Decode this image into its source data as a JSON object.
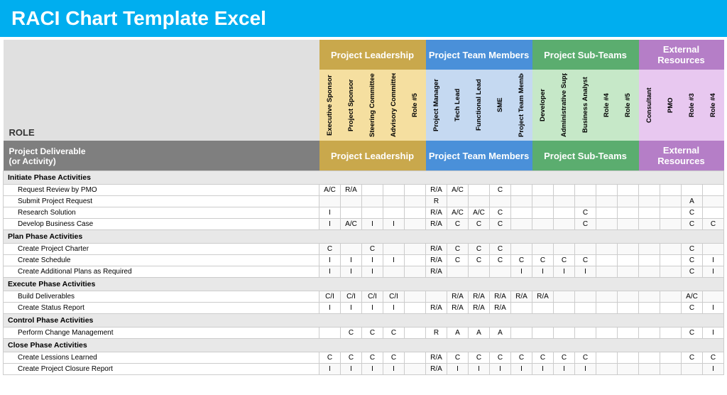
{
  "title": "RACI Chart Template Excel",
  "role_label": "ROLE",
  "deliverable_label": "Project Deliverable\n(or Activity)",
  "groups": [
    {
      "label": "Project Leadership",
      "class": "group-leadership",
      "col_class": "col-leadership",
      "span": 5
    },
    {
      "label": "Project Team Members",
      "class": "group-team",
      "col_class": "col-team",
      "span": 5
    },
    {
      "label": "Project Sub-Teams",
      "class": "group-subteams",
      "col_class": "col-subteams",
      "span": 5
    },
    {
      "label": "External Resources",
      "class": "group-external",
      "col_class": "col-external",
      "span": 4
    }
  ],
  "columns": [
    {
      "label": "Executive Sponsor",
      "group": "leadership"
    },
    {
      "label": "Project Sponsor",
      "group": "leadership"
    },
    {
      "label": "Steering Committee",
      "group": "leadership"
    },
    {
      "label": "Advisory Committee",
      "group": "leadership"
    },
    {
      "label": "Role #5",
      "group": "leadership"
    },
    {
      "label": "Project Manager",
      "group": "team"
    },
    {
      "label": "Tech Lead",
      "group": "team"
    },
    {
      "label": "Functional Lead",
      "group": "team"
    },
    {
      "label": "SME",
      "group": "team"
    },
    {
      "label": "Project Team Member",
      "group": "team"
    },
    {
      "label": "Developer",
      "group": "subteams"
    },
    {
      "label": "Administrative Support",
      "group": "subteams"
    },
    {
      "label": "Business Analyst",
      "group": "subteams"
    },
    {
      "label": "Role #4",
      "group": "subteams"
    },
    {
      "label": "Role #5",
      "group": "subteams"
    },
    {
      "label": "Consultant",
      "group": "external"
    },
    {
      "label": "PMO",
      "group": "external"
    },
    {
      "label": "Role #3",
      "group": "external"
    },
    {
      "label": "Role #4",
      "group": "external"
    }
  ],
  "phases": [
    {
      "label": "Initiate Phase Activities",
      "rows": [
        {
          "activity": "Request Review by PMO",
          "cells": [
            "A/C",
            "R/A",
            "",
            "",
            "",
            "R/A",
            "A/C",
            "",
            "C",
            "",
            "",
            "",
            "",
            "",
            "",
            "",
            "",
            "",
            ""
          ]
        },
        {
          "activity": "Submit Project Request",
          "cells": [
            "",
            "",
            "",
            "",
            "",
            "R",
            "",
            "",
            "",
            "",
            "",
            "",
            "",
            "",
            "",
            "",
            "",
            "A",
            ""
          ]
        },
        {
          "activity": "Research Solution",
          "cells": [
            "I",
            "",
            "",
            "",
            "",
            "R/A",
            "A/C",
            "A/C",
            "C",
            "",
            "",
            "",
            "C",
            "",
            "",
            "",
            "",
            "C",
            ""
          ]
        },
        {
          "activity": "Develop Business Case",
          "cells": [
            "I",
            "A/C",
            "I",
            "I",
            "",
            "R/A",
            "C",
            "C",
            "C",
            "",
            "",
            "",
            "C",
            "",
            "",
            "",
            "",
            "C",
            "C"
          ]
        }
      ]
    },
    {
      "label": "Plan Phase Activities",
      "rows": [
        {
          "activity": "Create Project Charter",
          "cells": [
            "C",
            "",
            "C",
            "",
            "",
            "R/A",
            "C",
            "C",
            "C",
            "",
            "",
            "",
            "",
            "",
            "",
            "",
            "",
            "C",
            ""
          ]
        },
        {
          "activity": "Create Schedule",
          "cells": [
            "I",
            "I",
            "I",
            "I",
            "",
            "R/A",
            "C",
            "C",
            "C",
            "C",
            "C",
            "C",
            "C",
            "",
            "",
            "",
            "",
            "C",
            "I"
          ]
        },
        {
          "activity": "Create Additional Plans as Required",
          "cells": [
            "I",
            "I",
            "I",
            "",
            "",
            "R/A",
            "",
            "",
            "",
            "I",
            "I",
            "I",
            "I",
            "",
            "",
            "",
            "",
            "C",
            "I"
          ]
        }
      ]
    },
    {
      "label": "Execute Phase Activities",
      "rows": [
        {
          "activity": "Build Deliverables",
          "cells": [
            "C/I",
            "C/I",
            "C/I",
            "C/I",
            "",
            "",
            "R/A",
            "R/A",
            "R/A",
            "R/A",
            "R/A",
            "",
            "",
            "",
            "",
            "",
            "",
            "A/C",
            ""
          ]
        },
        {
          "activity": "Create Status Report",
          "cells": [
            "I",
            "I",
            "I",
            "I",
            "",
            "R/A",
            "R/A",
            "R/A",
            "R/A",
            "",
            "",
            "",
            "",
            "",
            "",
            "",
            "",
            "C",
            "I"
          ]
        }
      ]
    },
    {
      "label": "Control Phase Activities",
      "rows": [
        {
          "activity": "Perform Change Management",
          "cells": [
            "",
            "C",
            "C",
            "C",
            "",
            "R",
            "A",
            "A",
            "A",
            "",
            "",
            "",
            "",
            "",
            "",
            "",
            "",
            "C",
            "I"
          ]
        }
      ]
    },
    {
      "label": "Close Phase Activities",
      "rows": [
        {
          "activity": "Create Lessions Learned",
          "cells": [
            "C",
            "C",
            "C",
            "C",
            "",
            "R/A",
            "C",
            "C",
            "C",
            "C",
            "C",
            "C",
            "C",
            "",
            "",
            "",
            "",
            "C",
            "C"
          ]
        },
        {
          "activity": "Create Project Closure Report",
          "cells": [
            "I",
            "I",
            "I",
            "I",
            "",
            "R/A",
            "I",
            "I",
            "I",
            "I",
            "I",
            "I",
            "I",
            "",
            "",
            "",
            "",
            "",
            "I"
          ]
        }
      ]
    }
  ]
}
